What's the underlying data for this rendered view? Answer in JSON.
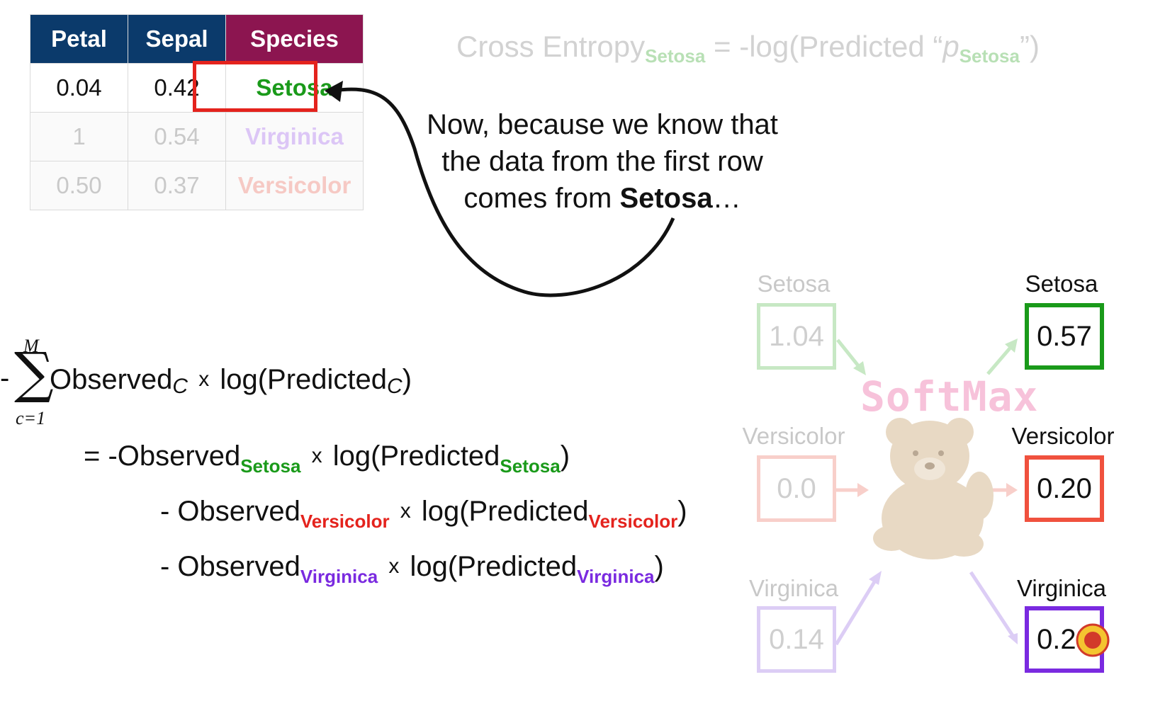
{
  "table": {
    "headers": [
      "Petal",
      "Sepal",
      "Species"
    ],
    "rows": [
      {
        "petal": "0.04",
        "sepal": "0.42",
        "species": "Setosa",
        "species_color": "#1a9a1a"
      },
      {
        "petal": "1",
        "sepal": "0.54",
        "species": "Virginica",
        "species_color": "#dcc6f6"
      },
      {
        "petal": "0.50",
        "sepal": "0.37",
        "species": "Versicolor",
        "species_color": "#f6c9c4"
      }
    ],
    "header_colors": {
      "features": "#0b3a6b",
      "species": "#8c1550"
    },
    "highlight_color": "#e4231d"
  },
  "top_formula": {
    "main": "Cross Entropy",
    "sub": "Setosa",
    "mid": " = -log(Predicted “",
    "p": "p",
    "sub2": "Setosa",
    "end": "”)"
  },
  "narration": {
    "line1": "Now, because we know that",
    "line2": "the data from the first row",
    "line3_pre": "comes from ",
    "line3_bold": "Setosa",
    "line3_post": "…"
  },
  "formula": {
    "sigma_top": "M",
    "sigma_bottom": "c=1",
    "minus": "-",
    "sum_term_a": "Observed",
    "sum_sub_a": "C",
    "times": "x",
    "sum_term_b": "log(Predicted",
    "sum_sub_b": "C",
    "close": ")",
    "line2_prefix": "= -Observed",
    "line2_sub1": "Setosa",
    "line2_mid": "log(Predicted",
    "line2_sub2": "Setosa",
    "line3_prefix": "- Observed",
    "line3_sub1": "Versicolor",
    "line3_mid": "log(Predicted",
    "line3_sub2": "Versicolor",
    "line4_prefix": "- Observed",
    "line4_sub1": "Virginica",
    "line4_mid": "log(Predicted",
    "line4_sub2": "Virginica"
  },
  "softmax": {
    "label": "SoftMax",
    "inputs": [
      {
        "label": "Setosa",
        "value": "1.04",
        "color": "#c7e8c4"
      },
      {
        "label": "Versicolor",
        "value": "0.0",
        "color": "#f8cfca"
      },
      {
        "label": "Virginica",
        "value": "0.14",
        "color": "#dccdf5"
      }
    ],
    "outputs": [
      {
        "label": "Setosa",
        "value": "0.57",
        "color": "#1a9a1a"
      },
      {
        "label": "Versicolor",
        "value": "0.20",
        "color": "#f0513e"
      },
      {
        "label": "Virginica",
        "value": "0.23",
        "color": "#7a2ae0"
      }
    ]
  }
}
